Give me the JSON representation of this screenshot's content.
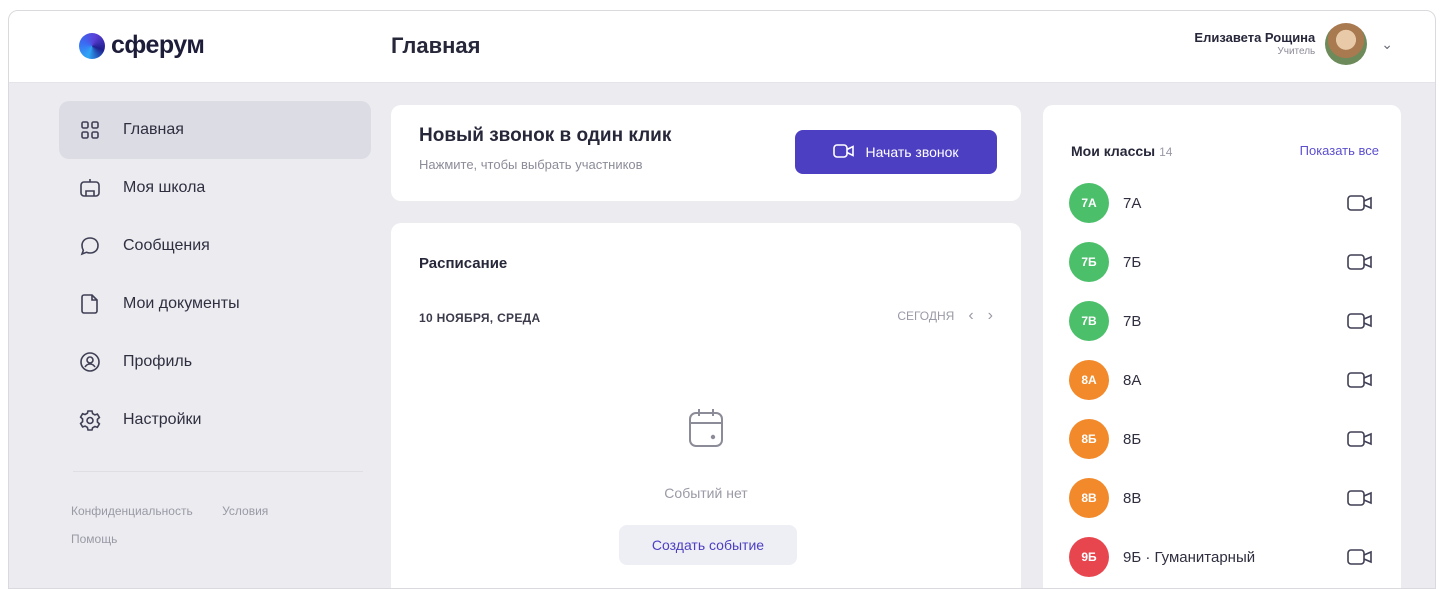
{
  "header": {
    "logo_text": "сферум",
    "page_title": "Главная",
    "user_name": "Елизавета Рощина",
    "user_role": "Учитель"
  },
  "sidebar": {
    "items": [
      {
        "label": "Главная",
        "icon": "home-grid-icon",
        "active": true
      },
      {
        "label": "Моя школа",
        "icon": "school-icon",
        "active": false
      },
      {
        "label": "Сообщения",
        "icon": "chat-bubble-icon",
        "active": false
      },
      {
        "label": "Мои документы",
        "icon": "document-icon",
        "active": false
      },
      {
        "label": "Профиль",
        "icon": "profile-icon",
        "active": false
      },
      {
        "label": "Настройки",
        "icon": "gear-icon",
        "active": false
      }
    ],
    "footer": {
      "privacy": "Конфиденциальность",
      "terms": "Условия",
      "help": "Помощь"
    }
  },
  "call_card": {
    "title": "Новый звонок в один клик",
    "subtitle": "Нажмите, чтобы выбрать участников",
    "button_label": "Начать звонок"
  },
  "schedule": {
    "title": "Расписание",
    "date": "10 НОЯБРЯ, СРЕДА",
    "today_label": "СЕГОДНЯ",
    "empty_text": "Событий нет",
    "create_button": "Создать событие"
  },
  "classes": {
    "title": "Мои классы",
    "count": "14",
    "show_all": "Показать все",
    "items": [
      {
        "badge": "7А",
        "name": "7А",
        "color": "#4cbf6b"
      },
      {
        "badge": "7Б",
        "name": "7Б",
        "color": "#4cbf6b"
      },
      {
        "badge": "7В",
        "name": "7В",
        "color": "#4cbf6b"
      },
      {
        "badge": "8А",
        "name": "8А",
        "color": "#f2892a"
      },
      {
        "badge": "8Б",
        "name": "8Б",
        "color": "#f2892a"
      },
      {
        "badge": "8В",
        "name": "8В",
        "color": "#f2892a"
      },
      {
        "badge": "9Б",
        "name": "9Б · Гуманитарный",
        "color": "#e8464f"
      }
    ]
  },
  "colors": {
    "accent": "#4d3fc2",
    "background": "#ebebf0"
  }
}
